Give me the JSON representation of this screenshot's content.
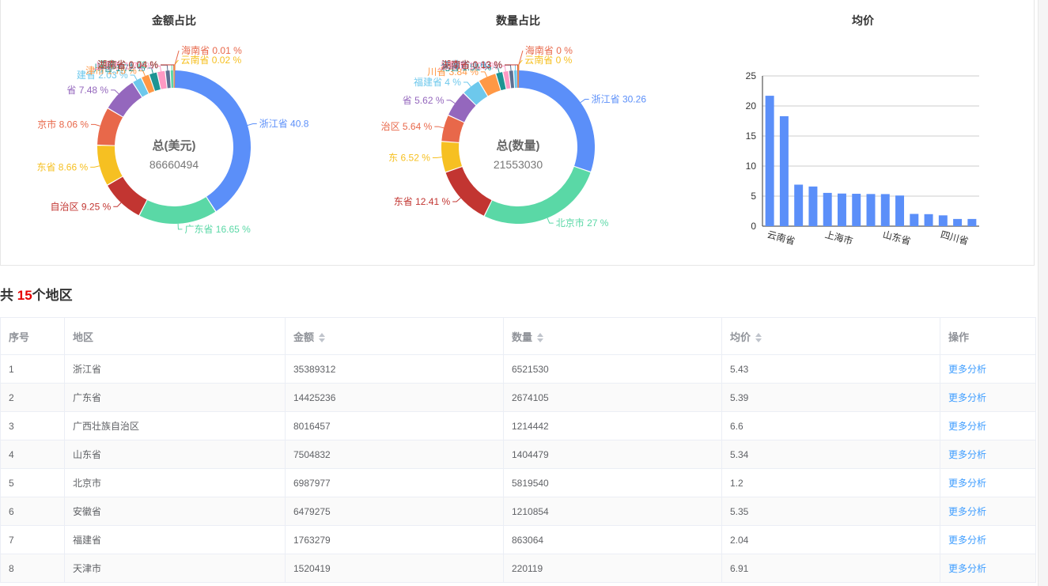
{
  "charts": {
    "amount": {
      "title": "金额占比",
      "center_label": "总(美元)",
      "center_value": "86660494"
    },
    "quantity": {
      "title": "数量占比",
      "center_label": "总(数量)",
      "center_value": "21553030"
    },
    "avg": {
      "title": "均价"
    }
  },
  "chart_data": [
    {
      "type": "pie",
      "title": "金额占比",
      "slices": [
        {
          "label": "浙江省 40.8",
          "value": 40.84,
          "color": "#5b8ff9"
        },
        {
          "label": "广东省 16.65 %",
          "value": 16.65,
          "color": "#5ad8a6"
        },
        {
          "label": "自治区 9.25 %",
          "value": 9.25,
          "color": "#c23531"
        },
        {
          "label": "东省 8.66 %",
          "value": 8.66,
          "color": "#f6c022"
        },
        {
          "label": "京市 8.06 %",
          "value": 8.06,
          "color": "#e8684a"
        },
        {
          "label": "省 7.48 %",
          "value": 7.48,
          "color": "#9467bd"
        },
        {
          "label": "建省 2.03 %",
          "value": 2.03,
          "color": "#6dc8ec"
        },
        {
          "label": "津市 1.75 %",
          "value": 1.75,
          "color": "#ff9845"
        },
        {
          "label": "川省 1.72 %",
          "value": 1.72,
          "color": "#1e9493"
        },
        {
          "label": "上海市 1.71 %",
          "value": 1.71,
          "color": "#ff99c3"
        },
        {
          "label": "江苏省 1.05 %",
          "value": 1.05,
          "color": "#5d7092"
        },
        {
          "label": "河北省 0.73 %",
          "value": 0.73,
          "color": "#5ad8a6"
        },
        {
          "label": "湖南省 0.04 %",
          "value": 0.04,
          "color": "#c23531"
        },
        {
          "label": "云南省 0.02 %",
          "value": 0.02,
          "color": "#f6c022"
        },
        {
          "label": "海南省 0.01 %",
          "value": 0.01,
          "color": "#e8684a"
        }
      ]
    },
    {
      "type": "pie",
      "title": "数量占比",
      "slices": [
        {
          "label": "浙江省 30.26",
          "value": 30.26,
          "color": "#5b8ff9"
        },
        {
          "label": "北京市 27 %",
          "value": 27.0,
          "color": "#5ad8a6"
        },
        {
          "label": "东省 12.41 %",
          "value": 12.41,
          "color": "#c23531"
        },
        {
          "label": "东 6.52 %",
          "value": 6.52,
          "color": "#f6c022"
        },
        {
          "label": "治区 5.64 %",
          "value": 5.64,
          "color": "#e8684a"
        },
        {
          "label": "省 5.62 %",
          "value": 5.62,
          "color": "#9467bd"
        },
        {
          "label": "福建省 4 %",
          "value": 4.0,
          "color": "#6dc8ec"
        },
        {
          "label": "川省 3.84 %",
          "value": 3.84,
          "color": "#ff9845"
        },
        {
          "label": "北省 1.51 %",
          "value": 1.51,
          "color": "#1e9493"
        },
        {
          "label": "上海市 1.23 %",
          "value": 1.23,
          "color": "#ff99c3"
        },
        {
          "label": "天津市 1.02 %",
          "value": 1.02,
          "color": "#5d7092"
        },
        {
          "label": "江苏省 0.82 %",
          "value": 0.82,
          "color": "#6dc8ec"
        },
        {
          "label": "湖南省 0.13 %",
          "value": 0.13,
          "color": "#c23531"
        },
        {
          "label": "云南省 0 %",
          "value": 0.0,
          "color": "#f6c022"
        },
        {
          "label": "海南省 0 %",
          "value": 0.0,
          "color": "#e8684a"
        }
      ]
    },
    {
      "type": "bar",
      "title": "均价",
      "values": [
        21.7,
        18.3,
        6.91,
        6.6,
        5.54,
        5.43,
        5.39,
        5.35,
        5.34,
        5.1,
        2.04,
        2.0,
        1.8,
        1.2,
        1.2
      ],
      "tick_labels": [
        "云南省",
        "上海市",
        "山东省",
        "四川省"
      ],
      "tick_label_indices": [
        0,
        4,
        8,
        12
      ],
      "ylim": [
        0,
        25
      ],
      "yticks": [
        0,
        5,
        10,
        15,
        20,
        25
      ],
      "color": "#5b8ff9",
      "grid": true
    }
  ],
  "summary": {
    "prefix": "共 ",
    "count": "15",
    "suffix": "个地区"
  },
  "table": {
    "headers": {
      "index": "序号",
      "region": "地区",
      "amount": "金额",
      "quantity": "数量",
      "avg": "均价",
      "action": "操作"
    },
    "rows": [
      {
        "index": "1",
        "region": "浙江省",
        "amount": "35389312",
        "quantity": "6521530",
        "avg": "5.43",
        "action": "更多分析"
      },
      {
        "index": "2",
        "region": "广东省",
        "amount": "14425236",
        "quantity": "2674105",
        "avg": "5.39",
        "action": "更多分析"
      },
      {
        "index": "3",
        "region": "广西壮族自治区",
        "amount": "8016457",
        "quantity": "1214442",
        "avg": "6.6",
        "action": "更多分析"
      },
      {
        "index": "4",
        "region": "山东省",
        "amount": "7504832",
        "quantity": "1404479",
        "avg": "5.34",
        "action": "更多分析"
      },
      {
        "index": "5",
        "region": "北京市",
        "amount": "6987977",
        "quantity": "5819540",
        "avg": "1.2",
        "action": "更多分析"
      },
      {
        "index": "6",
        "region": "安徽省",
        "amount": "6479275",
        "quantity": "1210854",
        "avg": "5.35",
        "action": "更多分析"
      },
      {
        "index": "7",
        "region": "福建省",
        "amount": "1763279",
        "quantity": "863064",
        "avg": "2.04",
        "action": "更多分析"
      },
      {
        "index": "8",
        "region": "天津市",
        "amount": "1520419",
        "quantity": "220119",
        "avg": "6.91",
        "action": "更多分析"
      }
    ]
  }
}
